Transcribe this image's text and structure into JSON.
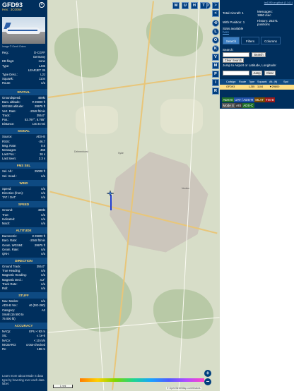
{
  "aircraft": {
    "callsign": "GFD93",
    "hex_line": "Hex : 3C0069",
    "photo_credit": "Image © Gerrit Griem"
  },
  "info_rows": [
    {
      "label": "Reg.:",
      "value": "D-CGFF"
    },
    {
      "label": "",
      "value": "Germany"
    },
    {
      "label": "DB flags:",
      "value": "none"
    },
    {
      "label": "Type:",
      "value": "LJ35"
    },
    {
      "label": "",
      "value": "LEARJET 35"
    },
    {
      "label": "Type Desc.:",
      "value": "L2J"
    },
    {
      "label": "Squawk:",
      "value": "1104"
    },
    {
      "label": "Route:",
      "value": "n/a"
    }
  ],
  "sections": {
    "spatial": {
      "title": "SPATIAL",
      "rows": [
        {
          "label": "Groundspeed:",
          "value": "469kt"
        },
        {
          "label": "Baro. altitude:",
          "value": "▼29800 ft"
        },
        {
          "label": "WGS84 altitude:",
          "value": "29975 ft"
        },
        {
          "label": "Vert. Rate:",
          "value": "-2048 ft/min"
        },
        {
          "label": "Track:",
          "value": "355.0°"
        },
        {
          "label": "Pos.:",
          "value": "52.797°, 8.765°"
        },
        {
          "label": "Distance:",
          "value": "140.6 nmi"
        }
      ]
    },
    "signal": {
      "title": "SIGNAL",
      "rows": [
        {
          "label": "Source:",
          "value": "ADS-B"
        },
        {
          "label": "RSSI:",
          "value": "-26.7"
        },
        {
          "label": "Msg. Rate:",
          "value": "0.5"
        },
        {
          "label": "Messages:",
          "value": "468"
        },
        {
          "label": "Last Pos.:",
          "value": "26 s"
        },
        {
          "label": "Last Seen:",
          "value": "2.3 s"
        }
      ]
    },
    "fms": {
      "title": "FMS SEL",
      "rows": [
        {
          "label": "Sel. Alt.:",
          "value": "25008 ft"
        },
        {
          "label": "Sel. Head.:",
          "value": "n/a"
        }
      ]
    },
    "wind": {
      "title": "WIND",
      "rows": [
        {
          "label": "Speed:",
          "value": "n/a"
        },
        {
          "label": "Direction (from):",
          "value": "n/a"
        },
        {
          "label": "TAT / OAT:",
          "value": "n/a"
        }
      ]
    },
    "speed": {
      "title": "SPEED",
      "rows": [
        {
          "label": "Ground:",
          "value": "469kt"
        },
        {
          "label": "True:",
          "value": "n/a"
        },
        {
          "label": "Indicated:",
          "value": "n/a"
        },
        {
          "label": "Mach:",
          "value": "n/a"
        }
      ]
    },
    "altitude": {
      "title": "ALTITUDE",
      "rows": [
        {
          "label": "Barometric:",
          "value": "▼29800 ft"
        },
        {
          "label": "Baro. Rate:",
          "value": "-2048 ft/min"
        },
        {
          "label": "Geom. WGS84:",
          "value": "29975 ft"
        },
        {
          "label": "Geom. Rate:",
          "value": "n/a"
        },
        {
          "label": "QNH:",
          "value": "n/a"
        }
      ]
    },
    "direction": {
      "title": "DIRECTION",
      "rows": [
        {
          "label": "Ground Track:",
          "value": "355.0°"
        },
        {
          "label": "True Heading:",
          "value": "n/a"
        },
        {
          "label": "Magnetic Heading:",
          "value": "n/a"
        },
        {
          "label": "Magnetic Decl.:",
          "value": "4.2°"
        },
        {
          "label": "Track Rate:",
          "value": "n/a"
        },
        {
          "label": "Roll:",
          "value": "n/a"
        }
      ]
    },
    "stuff": {
      "title": "STUFF",
      "rows": [
        {
          "label": "Nav. Modes:",
          "value": "n/a"
        },
        {
          "label": "ADS-B Ver.:",
          "value": "v0 (DO-260)"
        },
        {
          "label": "Category:",
          "value": "A2"
        },
        {
          "label": "Small (15 500 to",
          "value": ""
        },
        {
          "label": "75 000 lb)",
          "value": ""
        }
      ]
    },
    "accuracy": {
      "title": "ACCURACY",
      "rows": [
        {
          "label": "NACp:",
          "value": "EPU < 92 m"
        },
        {
          "label": "SIL:",
          "value": "≤ 1e-5"
        },
        {
          "label": "NACv:",
          "value": "< 10 m/s"
        },
        {
          "label": "NICBARO:",
          "value": "cross-checked"
        },
        {
          "label": "Rc:",
          "value": "186 m"
        }
      ]
    }
  },
  "learn_more": "Learn more about Mode S data type by hovering over each data label.",
  "map": {
    "top_buttons": [
      "M",
      "U",
      "H",
      "T"
    ],
    "side_buttons": [
      "<",
      "⟲",
      "L",
      "O",
      "K",
      "V",
      "M",
      "P",
      "I",
      "R"
    ],
    "scale_label": "1 nmi",
    "attribution": "© OpenStreetMap contributors",
    "towns": [
      "Delmenhorst",
      "Verden",
      "Syke"
    ]
  },
  "sidebar": {
    "github": "tar1090 on github (3.14.1)",
    "total_aircraft": "Total Aircraft: 1",
    "with_position": "With Position: 1",
    "stats_label": "Stats available",
    "stats_link": "here",
    "messages_label": "Messages:",
    "messages_value": "1860 /sec",
    "history_label": "History: 25271",
    "history_unit": "positions",
    "tabs": [
      "Search",
      "Filters",
      "Columns"
    ],
    "search_label": "Search:",
    "search_button": "Search",
    "clear_search": "Clear Search",
    "jump_label": "Jump to Airport or Latitude, Longitude:",
    "jump_button": "Jump",
    "clear_button": "Clear",
    "columns": [
      "",
      "Callsign",
      "Route",
      "Type",
      "Squawk",
      "Alt. (ft)",
      "Spd"
    ],
    "row": [
      "",
      "GFD93",
      "",
      "LJ35",
      "1104",
      "▼29800",
      ""
    ],
    "source_chips": [
      {
        "label": "ADS-B",
        "color": "#1f6e2a"
      },
      {
        "label": "UAT / ADS-R",
        "color": "#1f4fa8"
      },
      {
        "label": "MLAT",
        "color": "#7a4a00"
      },
      {
        "label": "TIS-B",
        "color": "#9a1a1a"
      },
      {
        "label": "Mode S",
        "color": "#555555"
      },
      {
        "label": "AIS",
        "color": "#3a3a3a"
      },
      {
        "label": "ADS-C",
        "color": "#1f6e2a"
      }
    ]
  }
}
